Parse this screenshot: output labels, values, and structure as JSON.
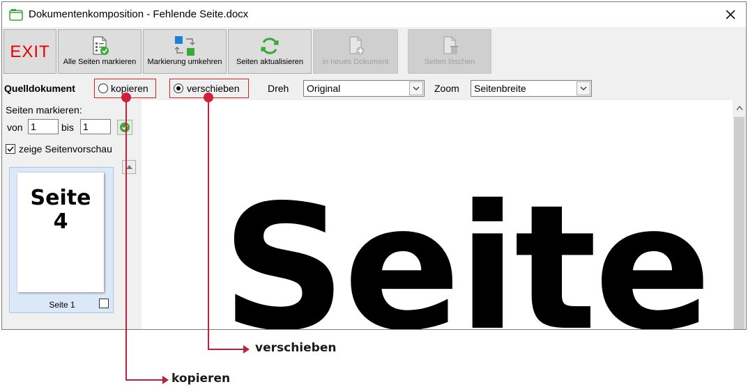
{
  "window": {
    "title": "Dokumentenkomposition - Fehlende Seite.docx"
  },
  "toolbar": {
    "exit_label": "EXIT",
    "mark_all_label": "Alle Seiten markieren",
    "invert_label": "Markierung umkehren",
    "refresh_label": "Seiten aktualisieren",
    "new_doc_label": "in neues Dokument",
    "delete_label": "Seiten löschen"
  },
  "options": {
    "source_label": "Quelldokument",
    "copy_label": "kopieren",
    "move_label": "verschieben",
    "selected_mode": "verschieben",
    "rotate_label": "Dreh",
    "rotate_value": "Original",
    "zoom_label": "Zoom",
    "zoom_value": "Seitenbreite"
  },
  "left_panel": {
    "mark_label": "Seiten markieren:",
    "from_label": "von",
    "from_value": "1",
    "to_label": "bis",
    "to_value": "1",
    "preview_label": "zeige Seitenvorschau",
    "preview_checked": true,
    "thumbnail": {
      "title_line1": "Seite",
      "title_line2": "4",
      "caption": "Seite 1",
      "checked": false
    }
  },
  "preview": {
    "text": "Seite"
  },
  "callouts": {
    "move": "verschieben",
    "copy": "kopieren"
  },
  "colors": {
    "exit": "#e00000",
    "callout": "#c41e3a",
    "annotation_box": "#e02020",
    "accent_green": "#3aaa35",
    "accent_blue": "#1f7fd6"
  },
  "icons": {
    "app": "document-composition-icon",
    "mark_all": "checklist-icon",
    "invert": "swap-squares-icon",
    "refresh": "refresh-icon",
    "new_doc": "new-document-icon",
    "delete": "delete-page-icon"
  }
}
